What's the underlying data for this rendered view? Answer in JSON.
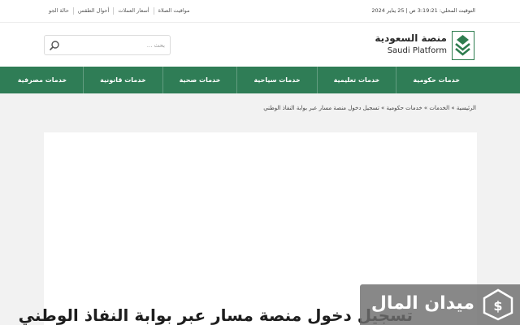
{
  "top_bar": {
    "links": [
      "حالة الجو",
      "أحوال الطقس",
      "أسعار العملات",
      "مواقيت الصلاة"
    ],
    "local_time": "التوقيت المحلي: 3:19:21 ص | 25 يناير 2024"
  },
  "header": {
    "search_placeholder": "بحث ...",
    "logo_ar": "منصة السعودية",
    "logo_en": "Saudi Platform"
  },
  "nav": {
    "items": [
      "خدمات حكومية",
      "خدمات تعليمية",
      "خدمات سياحية",
      "خدمات صحية",
      "خدمات قانونية",
      "خدمات مصرفية"
    ]
  },
  "breadcrumb": {
    "home": "الرئيسية",
    "sep": " » ",
    "services": "الخدمات",
    "gov": "خدمات حكومية",
    "current": "تسجيل دخول منصة مسار عبر بوابة النفاذ الوطني"
  },
  "article": {
    "title": "تسجيل دخول منصة مسار عبر بوابة النفاذ الوطني"
  },
  "watermark": {
    "text": "ميدان المال"
  },
  "colors": {
    "nav_green": "#2f7d56",
    "logo_green": "#2e7d4f"
  }
}
